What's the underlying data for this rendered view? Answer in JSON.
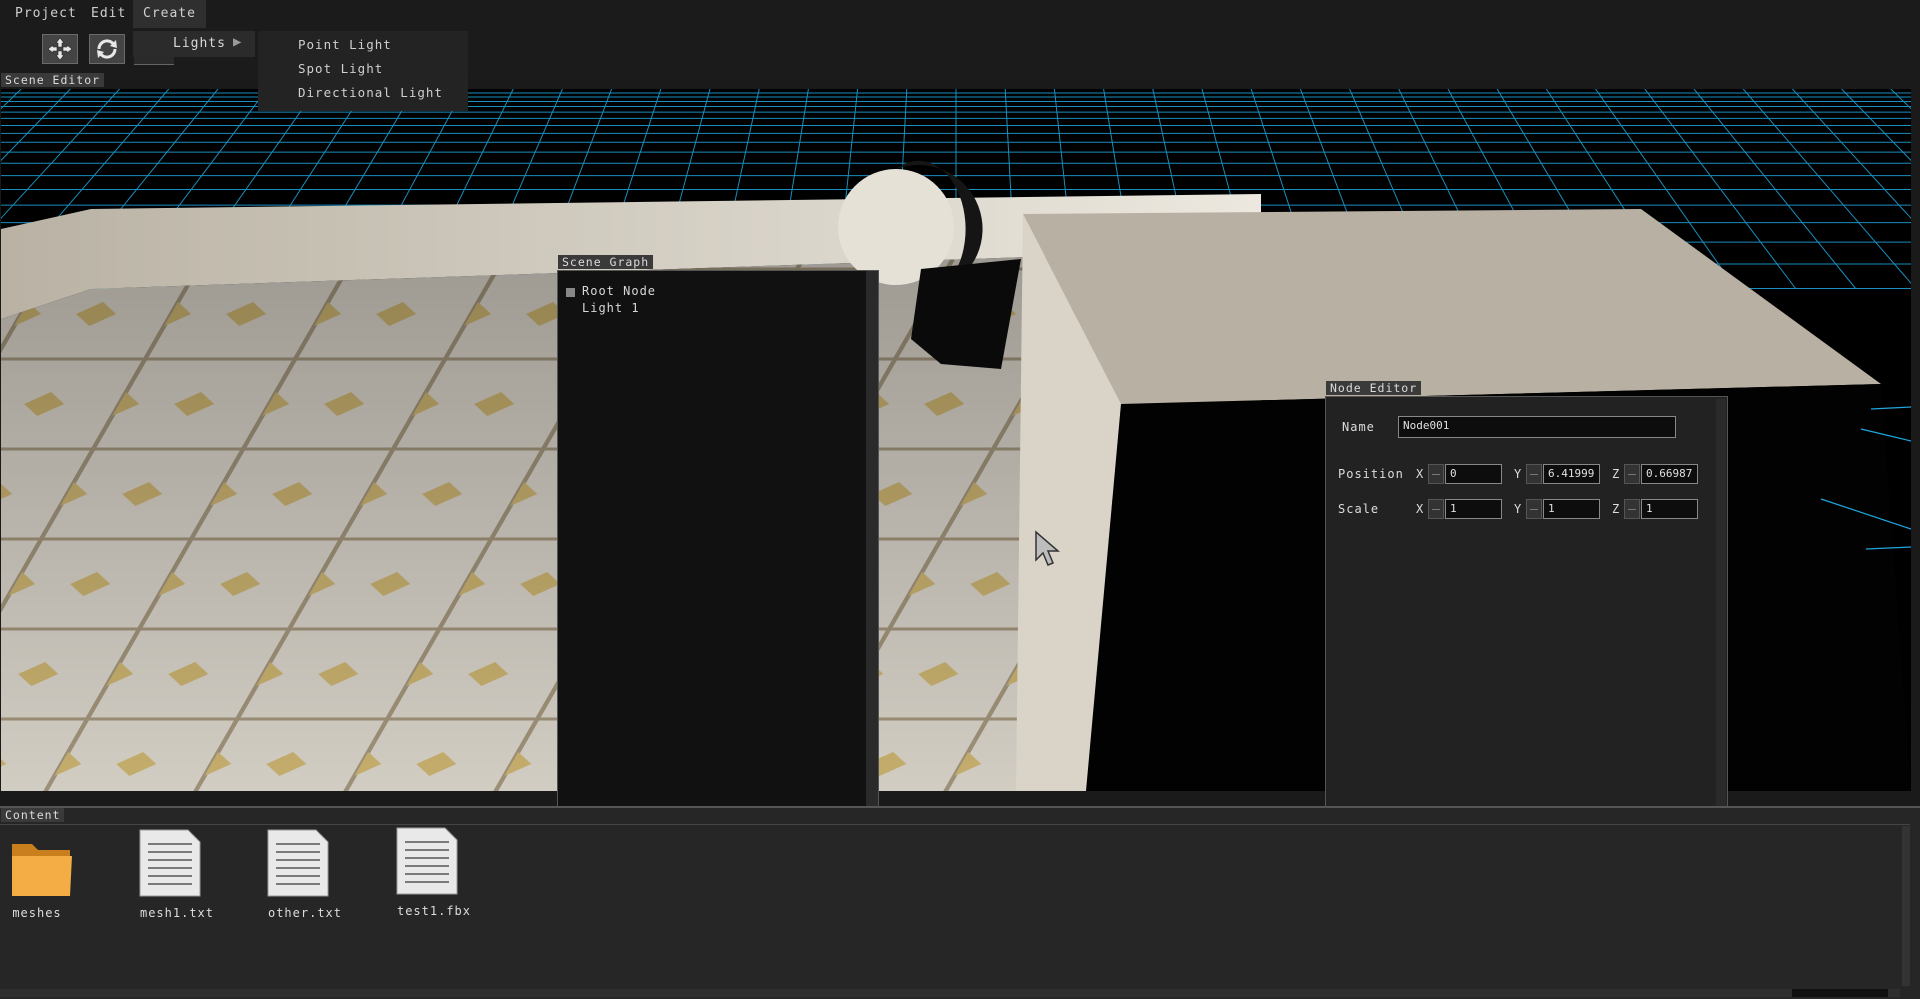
{
  "menubar": {
    "items": [
      "Project",
      "Edit",
      "Create"
    ]
  },
  "create_menu": {
    "lights_label": "Lights",
    "lights_submenu": [
      "Point Light",
      "Spot Light",
      "Directional Light"
    ]
  },
  "panels": {
    "scene_editor_title": "Scene Editor",
    "scene_graph_title": "Scene Graph",
    "node_editor_title": "Node Editor",
    "content_title": "Content"
  },
  "scene_graph": {
    "nodes": [
      "Root Node",
      "Light 1"
    ]
  },
  "node_editor": {
    "name_label": "Name",
    "name_value": "Node001",
    "position_label": "Position",
    "scale_label": "Scale",
    "axis_labels": [
      "X",
      "Y",
      "Z"
    ],
    "position": [
      "0",
      "6.41999",
      "0.66987"
    ],
    "scale": [
      "1",
      "1",
      "1"
    ]
  },
  "content": {
    "files": [
      {
        "name": "meshes",
        "icon": "folder-icon"
      },
      {
        "name": "mesh1.txt",
        "icon": "document-icon"
      },
      {
        "name": "other.txt",
        "icon": "document-icon"
      },
      {
        "name": "test1.fbx",
        "icon": "document-icon"
      }
    ]
  },
  "colors": {
    "grid": "#1fa7e0",
    "floor_tile": "#cfcac0",
    "accent_folder": "#f0a838"
  }
}
